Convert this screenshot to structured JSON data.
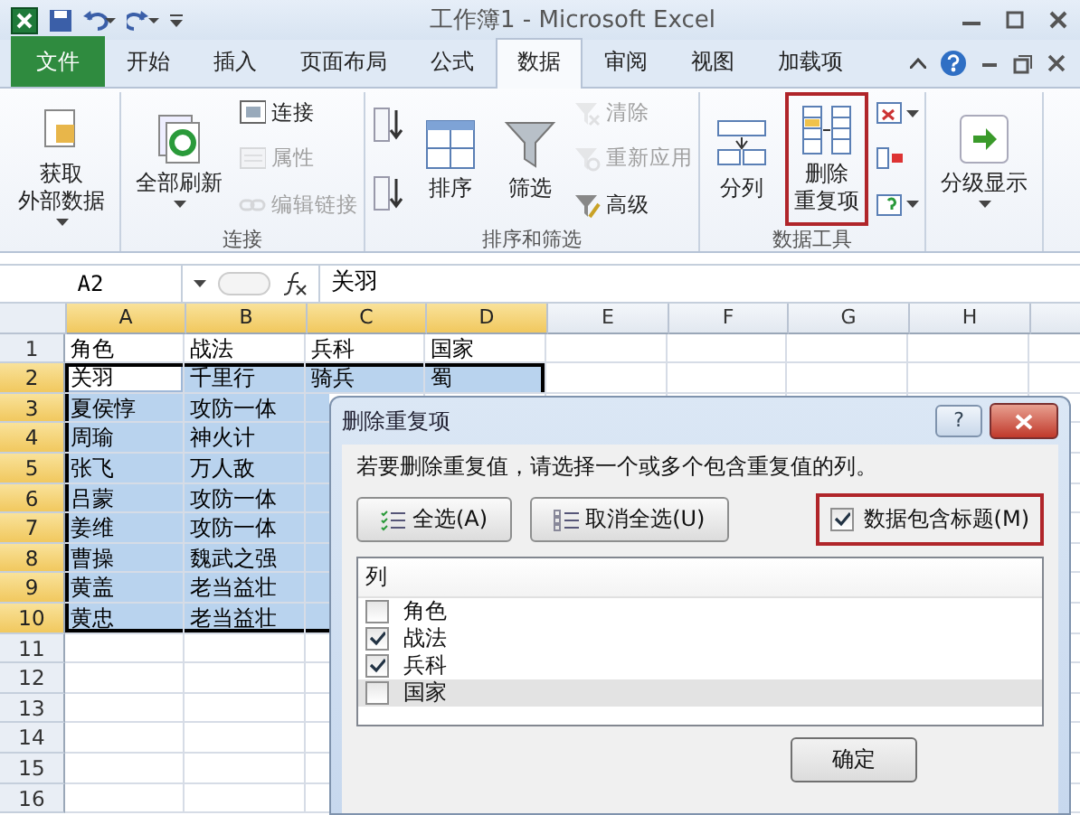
{
  "title_bar": {
    "title": "工作簿1 - Microsoft Excel"
  },
  "tabs": [
    {
      "label": "文件",
      "kind": "file",
      "selected": false
    },
    {
      "label": "开始",
      "kind": "tab",
      "selected": false
    },
    {
      "label": "插入",
      "kind": "tab",
      "selected": false
    },
    {
      "label": "页面布局",
      "kind": "tab",
      "selected": false
    },
    {
      "label": "公式",
      "kind": "tab",
      "selected": false
    },
    {
      "label": "数据",
      "kind": "tab",
      "selected": true
    },
    {
      "label": "审阅",
      "kind": "tab",
      "selected": false
    },
    {
      "label": "视图",
      "kind": "tab",
      "selected": false
    },
    {
      "label": "加载项",
      "kind": "tab",
      "selected": false
    }
  ],
  "ribbon": {
    "groups": [
      {
        "columns": [
          [
            {
              "kind": "large",
              "lines": [
                "获取",
                "外部数据"
              ],
              "dropdown": true,
              "disabled": false,
              "highlighted": false
            }
          ]
        ]
      },
      {
        "label": "连接",
        "columns": [
          [
            {
              "kind": "large",
              "label": "全部刷新",
              "dropdown": true,
              "disabled": false,
              "highlighted": false
            }
          ],
          [
            {
              "kind": "small",
              "label": "连接",
              "dropdown": false,
              "disabled": false,
              "highlighted": false
            },
            {
              "kind": "small",
              "label": "属性",
              "dropdown": false,
              "disabled": true,
              "highlighted": false
            },
            {
              "kind": "small",
              "label": "编辑链接",
              "dropdown": false,
              "disabled": true,
              "highlighted": false
            }
          ]
        ]
      },
      {
        "label": "排序和筛选",
        "columns": [
          [
            {
              "kind": "icon",
              "dropdown": false,
              "disabled": false,
              "highlighted": false
            },
            {
              "kind": "icon",
              "dropdown": false,
              "disabled": false,
              "highlighted": false
            }
          ],
          [
            {
              "kind": "large",
              "label": "排序",
              "dropdown": false,
              "disabled": false,
              "highlighted": false
            }
          ],
          [
            {
              "kind": "large",
              "label": "筛选",
              "dropdown": false,
              "disabled": false,
              "highlighted": false
            }
          ],
          [
            {
              "kind": "small",
              "label": "清除",
              "dropdown": false,
              "disabled": true,
              "highlighted": false
            },
            {
              "kind": "small",
              "label": "重新应用",
              "dropdown": false,
              "disabled": true,
              "highlighted": false
            },
            {
              "kind": "small",
              "label": "高级",
              "dropdown": false,
              "disabled": false,
              "highlighted": false
            }
          ]
        ]
      },
      {
        "label": "数据工具",
        "columns": [
          [
            {
              "kind": "large",
              "label": "分列",
              "dropdown": false,
              "disabled": false,
              "highlighted": false
            }
          ],
          [
            {
              "kind": "large",
              "lines": [
                "删除",
                "重复项"
              ],
              "dropdown": false,
              "disabled": false,
              "highlighted": true
            }
          ],
          [
            {
              "kind": "icon",
              "dropdown": true,
              "disabled": false,
              "highlighted": false
            },
            {
              "kind": "icon",
              "dropdown": false,
              "disabled": false,
              "highlighted": false
            },
            {
              "kind": "icon",
              "dropdown": true,
              "disabled": false,
              "highlighted": false
            }
          ]
        ]
      },
      {
        "columns": [
          [
            {
              "kind": "large",
              "label": "分级显示",
              "dropdown": true,
              "disabled": false,
              "highlighted": false
            }
          ]
        ]
      }
    ]
  },
  "formula_bar": {
    "name_box": "A2",
    "formula": "关羽"
  },
  "sheet": {
    "columns": [
      {
        "label": "A",
        "selected": true
      },
      {
        "label": "B",
        "selected": true
      },
      {
        "label": "C",
        "selected": true
      },
      {
        "label": "D",
        "selected": true
      },
      {
        "label": "E",
        "selected": false
      },
      {
        "label": "F",
        "selected": false
      },
      {
        "label": "G",
        "selected": false
      },
      {
        "label": "H",
        "selected": false
      }
    ],
    "rows": [
      {
        "header": "1",
        "selected": false,
        "cells": [
          {
            "text": "角色",
            "active": false
          },
          {
            "text": "战法",
            "active": false
          },
          {
            "text": "兵科",
            "active": false
          },
          {
            "text": "国家",
            "active": false
          }
        ]
      },
      {
        "header": "2",
        "selected": true,
        "cells": [
          {
            "text": "关羽",
            "active": true
          },
          {
            "text": "千里行",
            "active": false
          },
          {
            "text": "骑兵",
            "active": false
          },
          {
            "text": "蜀",
            "active": false
          }
        ]
      },
      {
        "header": "3",
        "selected": true,
        "cells": [
          {
            "text": "夏侯惇",
            "active": false
          },
          {
            "text": "攻防一体",
            "active": false
          }
        ]
      },
      {
        "header": "4",
        "selected": true,
        "cells": [
          {
            "text": "周瑜",
            "active": false
          },
          {
            "text": "神火计",
            "active": false
          }
        ]
      },
      {
        "header": "5",
        "selected": true,
        "cells": [
          {
            "text": "张飞",
            "active": false
          },
          {
            "text": "万人敌",
            "active": false
          }
        ]
      },
      {
        "header": "6",
        "selected": true,
        "cells": [
          {
            "text": "吕蒙",
            "active": false
          },
          {
            "text": "攻防一体",
            "active": false
          }
        ]
      },
      {
        "header": "7",
        "selected": true,
        "cells": [
          {
            "text": "姜维",
            "active": false
          },
          {
            "text": "攻防一体",
            "active": false
          }
        ]
      },
      {
        "header": "8",
        "selected": true,
        "cells": [
          {
            "text": "曹操",
            "active": false
          },
          {
            "text": "魏武之强",
            "active": false
          }
        ]
      },
      {
        "header": "9",
        "selected": true,
        "cells": [
          {
            "text": "黄盖",
            "active": false
          },
          {
            "text": "老当益壮",
            "active": false
          }
        ]
      },
      {
        "header": "10",
        "selected": true,
        "cells": [
          {
            "text": "黄忠",
            "active": false
          },
          {
            "text": "老当益壮",
            "active": false
          }
        ]
      },
      {
        "header": "11",
        "selected": false,
        "cells": []
      },
      {
        "header": "12",
        "selected": false,
        "cells": []
      },
      {
        "header": "13",
        "selected": false,
        "cells": []
      },
      {
        "header": "14",
        "selected": false,
        "cells": []
      },
      {
        "header": "15",
        "selected": false,
        "cells": []
      },
      {
        "header": "16",
        "selected": false,
        "cells": []
      }
    ]
  },
  "dialog": {
    "title": "删除重复项",
    "help": "?",
    "instruction": "若要删除重复值，请选择一个或多个包含重复值的列。",
    "buttons": [
      {
        "label": "全选(A)"
      },
      {
        "label": "取消全选(U)"
      }
    ],
    "header_checkbox": {
      "label": "数据包含标题(M)",
      "checked": true,
      "highlighted": true
    },
    "list_header": "列",
    "columns": [
      {
        "label": "角色",
        "checked": false,
        "selected": false
      },
      {
        "label": "战法",
        "checked": true,
        "selected": false
      },
      {
        "label": "兵科",
        "checked": true,
        "selected": false
      },
      {
        "label": "国家",
        "checked": false,
        "selected": true
      }
    ],
    "ok_button": "确定"
  }
}
